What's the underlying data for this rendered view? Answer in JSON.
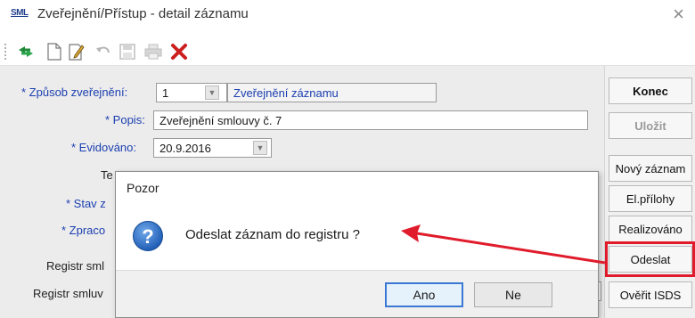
{
  "window": {
    "app_logo": "SML",
    "title": "Zveřejnění/Přístup - detail záznamu",
    "close_glyph": "×"
  },
  "toolbar": {
    "icons": [
      "refresh-arrows-icon",
      "new-document-icon",
      "edit-document-icon",
      "undo-icon",
      "save-icon",
      "print-icon",
      "delete-icon"
    ]
  },
  "form": {
    "zpusob_label": "* Způsob zveřejnění:",
    "zpusob_code": "1",
    "zpusob_value": "Zveřejnění záznamu",
    "popis_label": "* Popis:",
    "popis_value": "Zveřejnění smlouvy č. 7",
    "evidovano_label": "* Evidováno:",
    "evidovano_value": "20.9.2016",
    "te_label": "Te",
    "stav_label": "* Stav z",
    "zpraco_label": "* Zpraco",
    "registr1_label": "Registr sml",
    "registr2_label": "Registr smluv"
  },
  "right_buttons": {
    "konec": "Konec",
    "ulozit": "Uložit",
    "novy": "Nový záznam",
    "prilohy": "El.přílohy",
    "realizovano": "Realizováno",
    "odeslat": "Odeslat",
    "overit": "Ověřit ISDS"
  },
  "dialog": {
    "title": "Pozor",
    "message": "Odeslat záznam do registru ?",
    "yes": "Ano",
    "no": "Ne",
    "icon": "question-icon"
  },
  "colors": {
    "required_label": "#1b3fb0",
    "highlight": "#e01b2b",
    "dialog_icon": "#2b6fc7"
  }
}
